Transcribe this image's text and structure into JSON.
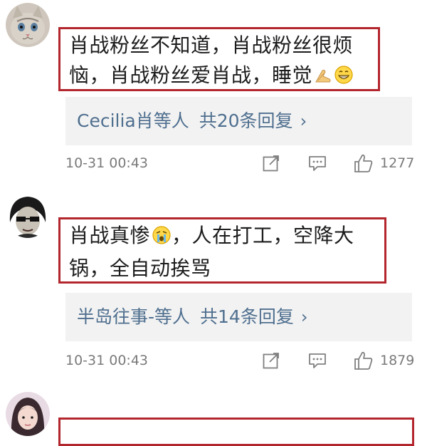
{
  "comments": [
    {
      "text_line1": "肖战粉丝不知道，肖战粉丝很烦",
      "text_line2": "恼，肖战粉丝爱肖战，睡觉",
      "emojis": [
        "praying-hands",
        "grinning-face"
      ],
      "replies": {
        "names": "Cecilia肖等人",
        "count_label": "共20条回复"
      },
      "time": "10-31 00:43",
      "likes": "1277"
    },
    {
      "text_line1": "肖战真惨",
      "text_line1_after": "，人在打工，空降大",
      "text_line2": "锅，全自动挨骂",
      "emojis": [
        "crying-face"
      ],
      "replies": {
        "names": "半岛往事-等人",
        "count_label": "共14条回复"
      },
      "time": "10-31 00:43",
      "likes": "1879"
    }
  ],
  "colors": {
    "highlight_border": "#b3262e",
    "reply_link": "#4f6f8f",
    "reply_bg": "#f2f2f2",
    "meta_text": "#7a7a7a"
  }
}
